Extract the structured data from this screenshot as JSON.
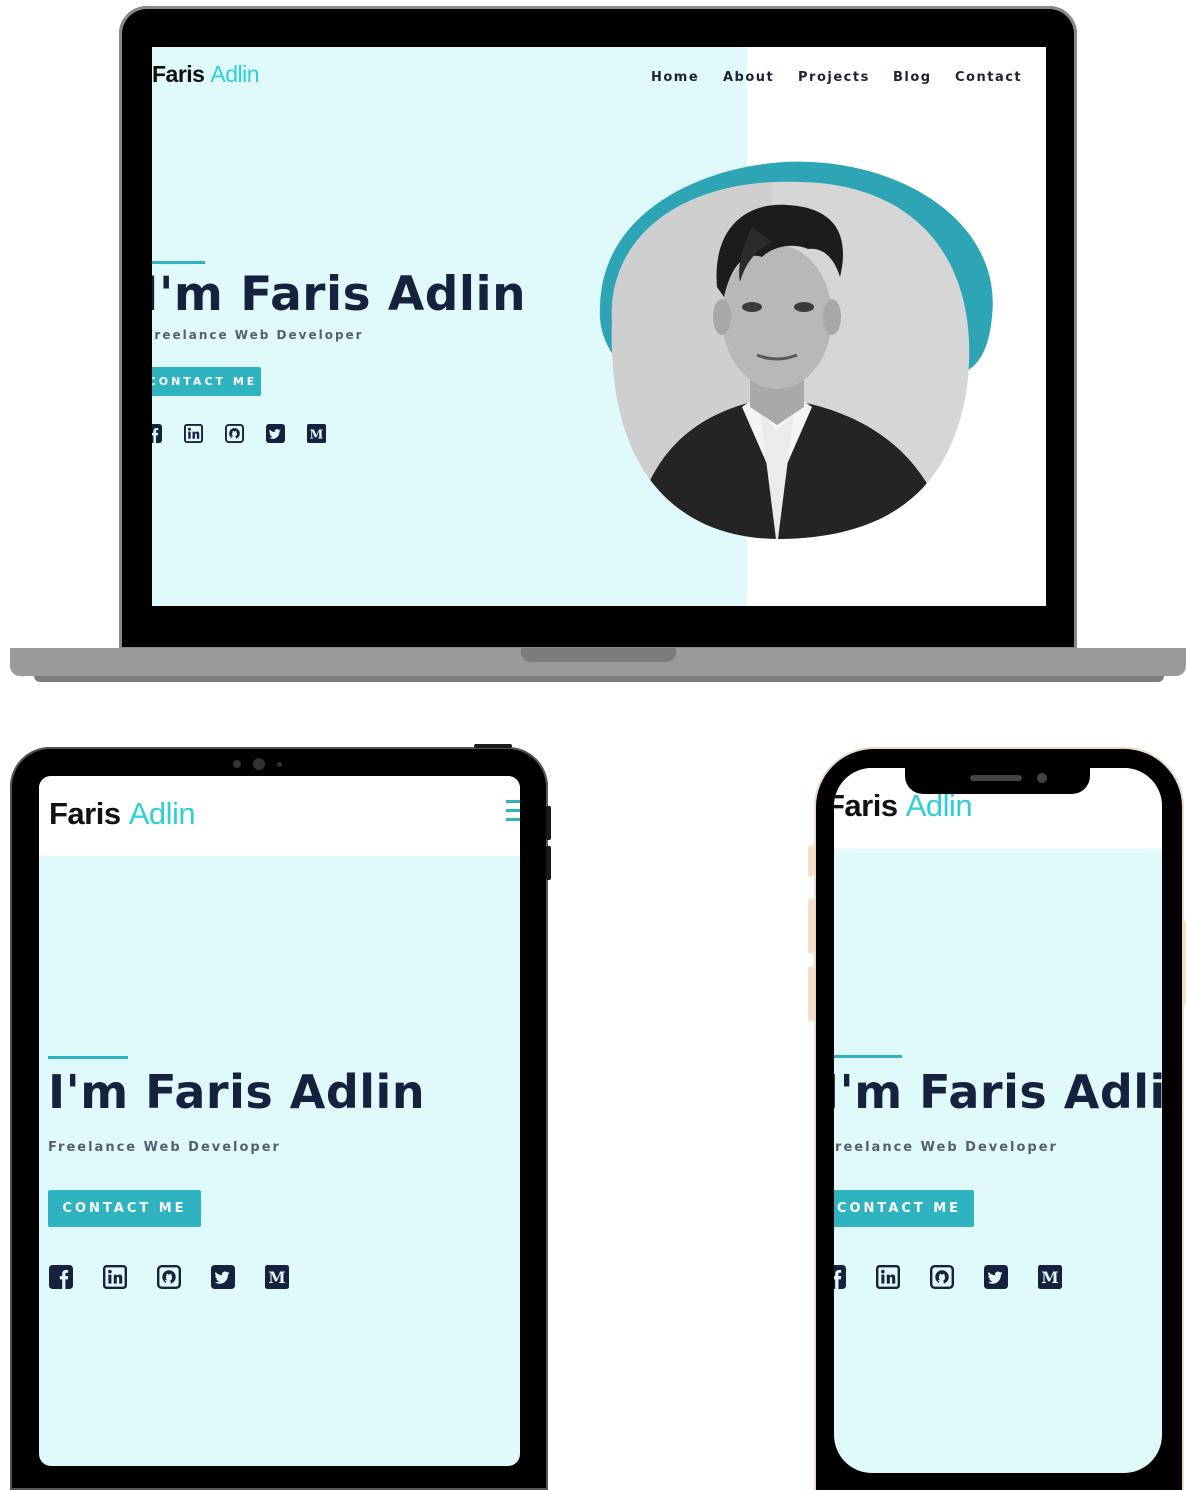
{
  "site": {
    "logo_first": "Faris",
    "logo_second": "Adlin",
    "nav": [
      "Home",
      "About",
      "Projects",
      "Blog",
      "Contact"
    ],
    "hero_title": "I'm Faris Adlin",
    "hero_subtitle": "Freelance Web Developer",
    "cta_label": "CONTACT ME",
    "socials": [
      "facebook-icon",
      "linkedin-icon",
      "github-icon",
      "twitter-icon",
      "medium-icon"
    ]
  },
  "colors": {
    "accent": "#2fb3c0",
    "logo_accent": "#2ed0d6",
    "hero_bg": "#e0f9fa",
    "title": "#16213e",
    "device_frame": "#000000",
    "laptop_base": "#9a9a9a"
  }
}
